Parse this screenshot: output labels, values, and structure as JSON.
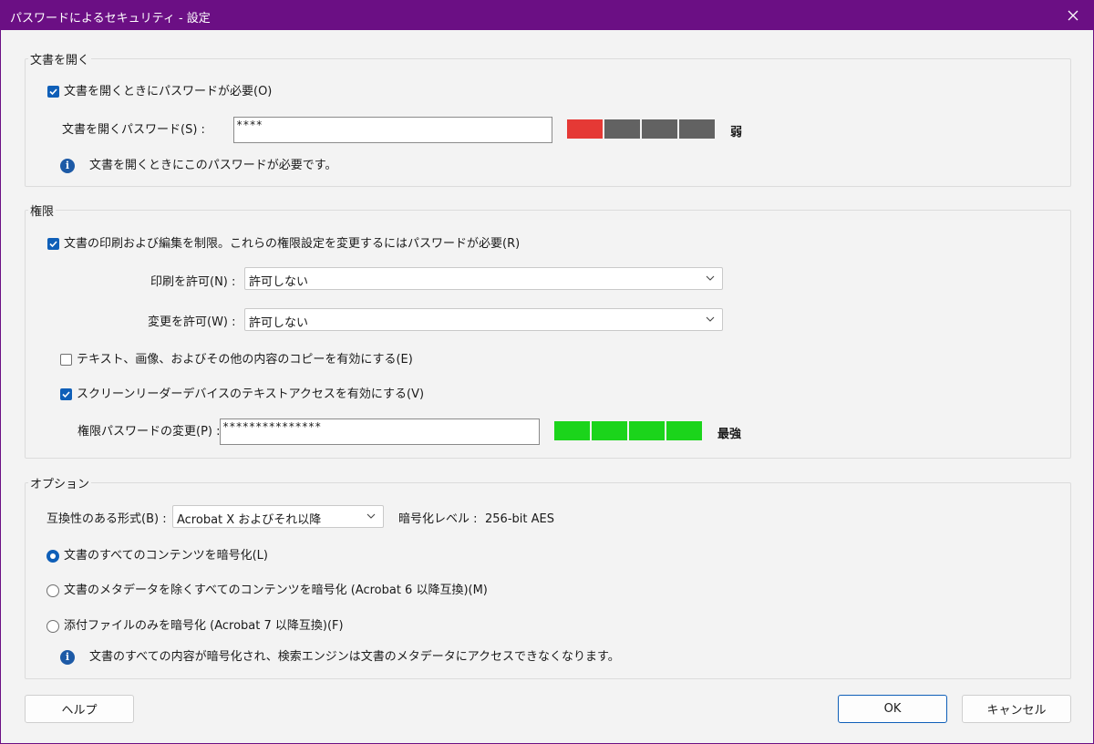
{
  "window": {
    "title": "パスワードによるセキュリティ - 設定"
  },
  "open_doc": {
    "group_label": "文書を開く",
    "require_checkbox": {
      "label": "文書を開くときにパスワードが必要(O)",
      "checked": true
    },
    "password_label": "文書を開くパスワード(S) :",
    "password_value": "****",
    "strength_colors": [
      "#e53935",
      "#626262",
      "#626262",
      "#626262"
    ],
    "strength_label": "弱",
    "info": "文書を開くときにこのパスワードが必要です。"
  },
  "permissions": {
    "group_label": "権限",
    "restrict_checkbox": {
      "label": "文書の印刷および編集を制限。これらの権限設定を変更するにはパスワードが必要(R)",
      "checked": true
    },
    "print_label": "印刷を許可(N) :",
    "print_value": "許可しない",
    "change_label": "変更を許可(W) :",
    "change_value": "許可しない",
    "copy_checkbox": {
      "label": "テキスト、画像、およびその他の内容のコピーを有効にする(E)",
      "checked": false
    },
    "reader_checkbox": {
      "label": "スクリーンリーダーデバイスのテキストアクセスを有効にする(V)",
      "checked": true
    },
    "password_label": "権限パスワードの変更(P) :",
    "password_value": "***************",
    "strength_colors": [
      "#1bd41b",
      "#1bd41b",
      "#1bd41b",
      "#1bd41b"
    ],
    "strength_label": "最強"
  },
  "options": {
    "group_label": "オプション",
    "compat_label": "互換性のある形式(B) :",
    "compat_value": "Acrobat X およびそれ以降",
    "enc_level_label": "暗号化レベル :",
    "enc_level_value": "256-bit AES",
    "radio_all": {
      "label": "文書のすべてのコンテンツを暗号化(L)",
      "selected": true
    },
    "radio_except_meta": {
      "label": "文書のメタデータを除くすべてのコンテンツを暗号化 (Acrobat 6 以降互換)(M)",
      "selected": false
    },
    "radio_attach": {
      "label": "添付ファイルのみを暗号化 (Acrobat 7 以降互換)(F)",
      "selected": false
    },
    "info": "文書のすべての内容が暗号化され、検索エンジンは文書のメタデータにアクセスできなくなります。"
  },
  "buttons": {
    "help": "ヘルプ",
    "ok": "OK",
    "cancel": "キャンセル"
  },
  "colors": {
    "titlebar": "#6b0f84",
    "accent": "#0f5fb8"
  }
}
